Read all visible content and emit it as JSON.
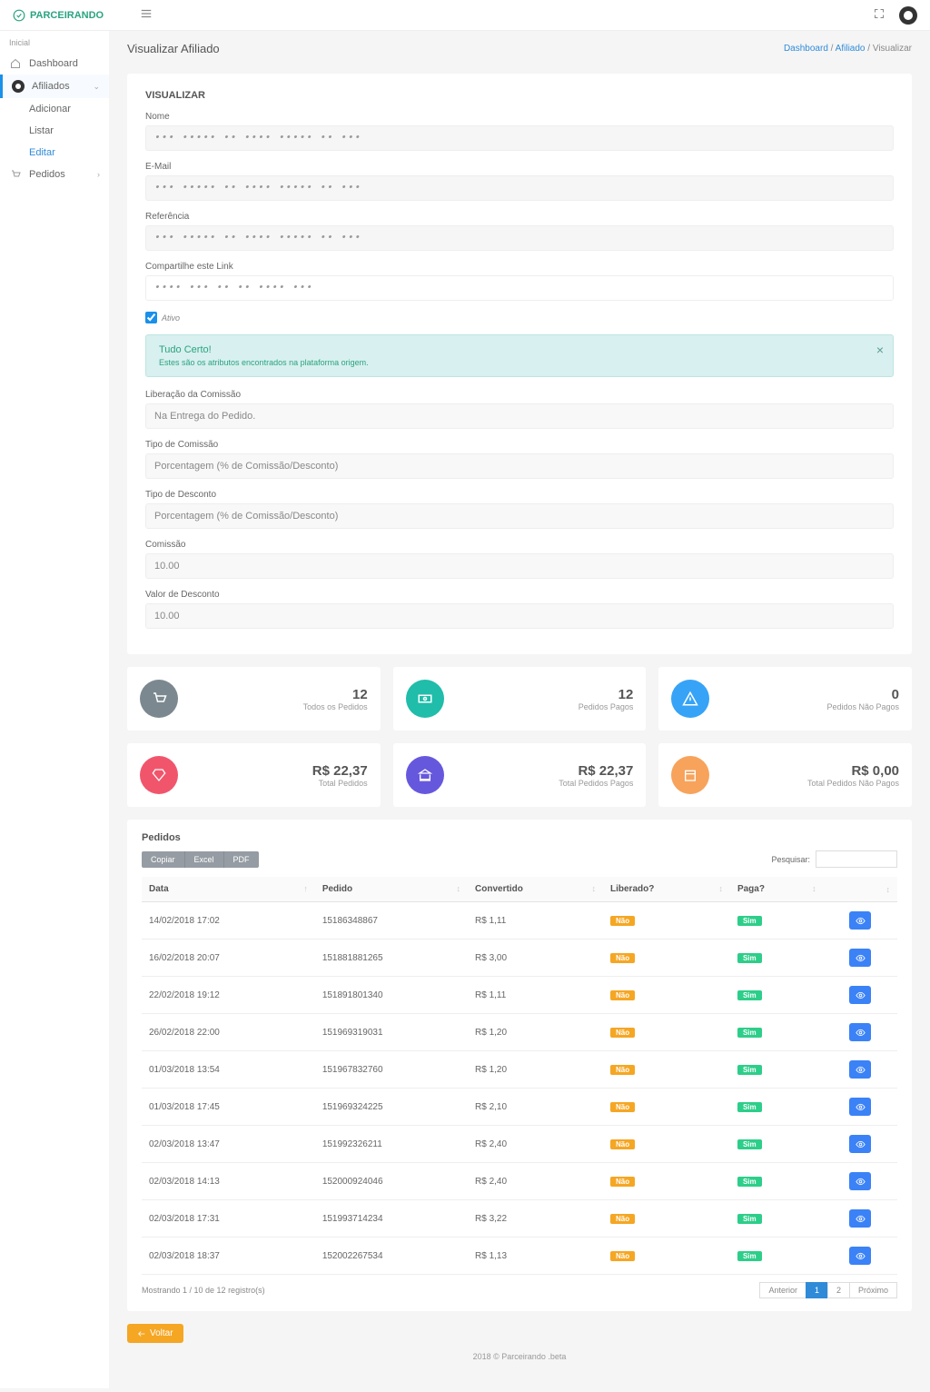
{
  "header": {
    "logo_text": "PARCEIRANDO"
  },
  "sidebar": {
    "section": "Inicial",
    "dashboard": "Dashboard",
    "afiliados": "Afiliados",
    "adicionar": "Adicionar",
    "listar": "Listar",
    "editar": "Editar",
    "pedidos": "Pedidos"
  },
  "page": {
    "title": "Visualizar Afiliado",
    "bc_dashboard": "Dashboard",
    "bc_afiliado": "Afiliado",
    "bc_visualizar": "Visualizar",
    "sep": " / "
  },
  "form": {
    "section": "VISUALIZAR",
    "nome_label": "Nome",
    "nome_val": "••• ••••• •• •••• ••••• •• •••",
    "email_label": "E-Mail",
    "email_val": "••• ••••• •• •••• ••••• •• •••",
    "ref_label": "Referência",
    "ref_val": "••• ••••• •• •••• ••••• •• •••",
    "share_label": "Compartilhe este Link",
    "share_val": "•••• ••• •• •• •••• •••",
    "ativo": "Ativo",
    "alert_title": "Tudo Certo!",
    "alert_sub": "Estes são os atributos encontrados na plataforma origem.",
    "lib_label": "Liberação da Comissão",
    "lib_val": "Na Entrega do Pedido.",
    "tipo_com_label": "Tipo de Comissão",
    "tipo_com_val": "Porcentagem (% de Comissão/Desconto)",
    "tipo_desc_label": "Tipo de Desconto",
    "tipo_desc_val": "Porcentagem (% de Comissão/Desconto)",
    "comissao_label": "Comissão",
    "comissao_val": "10.00",
    "valdesc_label": "Valor de Desconto",
    "valdesc_val": "10.00"
  },
  "stats1": [
    {
      "value": "12",
      "label": "Todos os Pedidos"
    },
    {
      "value": "12",
      "label": "Pedidos Pagos"
    },
    {
      "value": "0",
      "label": "Pedidos Não Pagos"
    }
  ],
  "stats2": [
    {
      "value": "R$ 22,37",
      "label": "Total Pedidos"
    },
    {
      "value": "R$ 22,37",
      "label": "Total Pedidos Pagos"
    },
    {
      "value": "R$ 0,00",
      "label": "Total Pedidos Não Pagos"
    }
  ],
  "table": {
    "title": "Pedidos",
    "export_copiar": "Copiar",
    "export_excel": "Excel",
    "export_pdf": "PDF",
    "search_label": "Pesquisar:",
    "cols": {
      "data": "Data",
      "pedido": "Pedido",
      "convertido": "Convertido",
      "liberado": "Liberado?",
      "paga": "Paga?"
    },
    "rows": [
      {
        "data": "14/02/2018 17:02",
        "pedido": "15186348867",
        "conv": "R$ 1,11",
        "lib": "Não",
        "paga": "Sim"
      },
      {
        "data": "16/02/2018 20:07",
        "pedido": "151881881265",
        "conv": "R$ 3,00",
        "lib": "Não",
        "paga": "Sim"
      },
      {
        "data": "22/02/2018 19:12",
        "pedido": "151891801340",
        "conv": "R$ 1,11",
        "lib": "Não",
        "paga": "Sim"
      },
      {
        "data": "26/02/2018 22:00",
        "pedido": "151969319031",
        "conv": "R$ 1,20",
        "lib": "Não",
        "paga": "Sim"
      },
      {
        "data": "01/03/2018 13:54",
        "pedido": "151967832760",
        "conv": "R$ 1,20",
        "lib": "Não",
        "paga": "Sim"
      },
      {
        "data": "01/03/2018 17:45",
        "pedido": "151969324225",
        "conv": "R$ 2,10",
        "lib": "Não",
        "paga": "Sim"
      },
      {
        "data": "02/03/2018 13:47",
        "pedido": "151992326211",
        "conv": "R$ 2,40",
        "lib": "Não",
        "paga": "Sim"
      },
      {
        "data": "02/03/2018 14:13",
        "pedido": "152000924046",
        "conv": "R$ 2,40",
        "lib": "Não",
        "paga": "Sim"
      },
      {
        "data": "02/03/2018 17:31",
        "pedido": "151993714234",
        "conv": "R$ 3,22",
        "lib": "Não",
        "paga": "Sim"
      },
      {
        "data": "02/03/2018 18:37",
        "pedido": "152002267534",
        "conv": "R$ 1,13",
        "lib": "Não",
        "paga": "Sim"
      }
    ],
    "info": "Mostrando 1 / 10 de 12 registro(s)",
    "anterior": "Anterior",
    "p1": "1",
    "p2": "2",
    "proximo": "Próximo"
  },
  "back": "Voltar",
  "footer": "2018 © Parceirando .beta"
}
